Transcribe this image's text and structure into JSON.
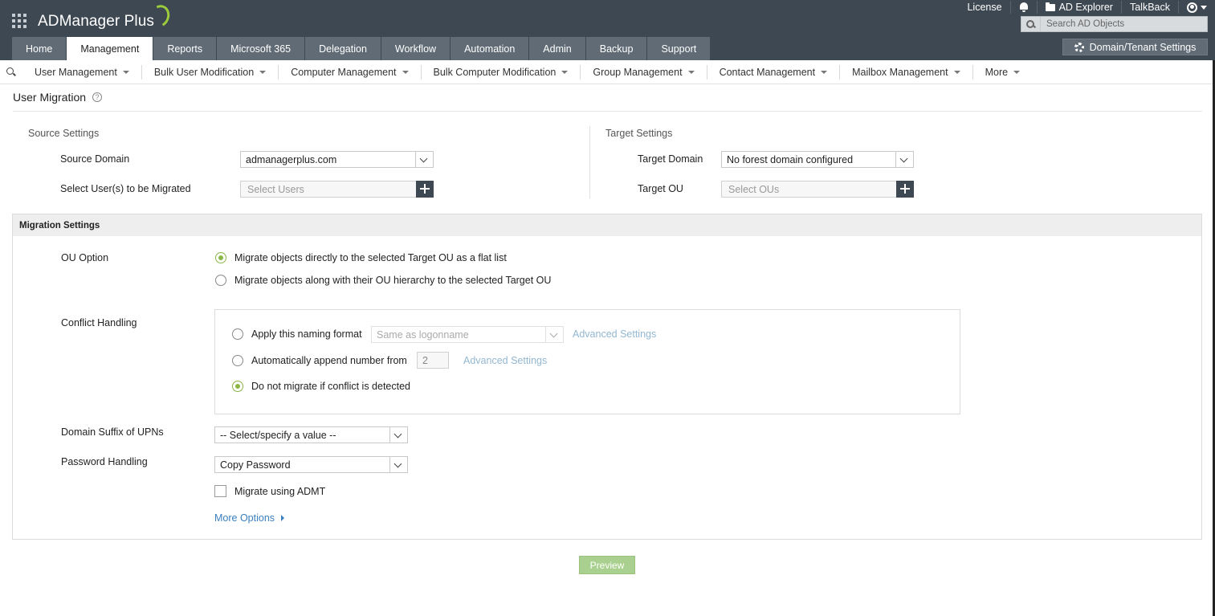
{
  "app": {
    "name": "ADManager Plus"
  },
  "header": {
    "links": {
      "license": "License",
      "ad_explorer": "AD Explorer",
      "talkback": "TalkBack"
    },
    "search_placeholder": "Search AD Objects",
    "domain_settings": "Domain/Tenant Settings"
  },
  "tabs": [
    {
      "label": "Home"
    },
    {
      "label": "Management"
    },
    {
      "label": "Reports"
    },
    {
      "label": "Microsoft 365"
    },
    {
      "label": "Delegation"
    },
    {
      "label": "Workflow"
    },
    {
      "label": "Automation"
    },
    {
      "label": "Admin"
    },
    {
      "label": "Backup"
    },
    {
      "label": "Support"
    }
  ],
  "active_tab": "Management",
  "submenu": [
    {
      "label": "User Management"
    },
    {
      "label": "Bulk User Modification"
    },
    {
      "label": "Computer Management"
    },
    {
      "label": "Bulk Computer Modification"
    },
    {
      "label": "Group Management"
    },
    {
      "label": "Contact Management"
    },
    {
      "label": "Mailbox Management"
    },
    {
      "label": "More"
    }
  ],
  "page": {
    "title": "User Migration",
    "help": "?"
  },
  "source": {
    "heading": "Source Settings",
    "domain_label": "Source Domain",
    "domain_value": "admanagerplus.com",
    "users_label": "Select User(s) to be Migrated",
    "users_placeholder": "Select Users"
  },
  "target": {
    "heading": "Target Settings",
    "domain_label": "Target Domain",
    "domain_value": "No forest domain configured",
    "ou_label": "Target OU",
    "ou_placeholder": "Select OUs"
  },
  "migration": {
    "heading": "Migration Settings",
    "ou_option_label": "OU Option",
    "ou_options": [
      {
        "label": "Migrate objects directly to the selected Target OU as a flat list",
        "selected": true
      },
      {
        "label": "Migrate objects along with their OU hierarchy to the selected Target OU",
        "selected": false
      }
    ],
    "conflict_label": "Conflict Handling",
    "conflict": {
      "naming_format_label": "Apply this naming format",
      "naming_format_value": "Same as logonname",
      "append_label": "Automatically append number from",
      "append_value": "2",
      "advanced": "Advanced Settings",
      "do_not_migrate_label": "Do not migrate if conflict is detected",
      "selected": "do_not_migrate"
    },
    "upn_label": "Domain Suffix of UPNs",
    "upn_value": "-- Select/specify a value --",
    "password_label": "Password Handling",
    "password_value": "Copy Password",
    "admt_label": "Migrate using ADMT",
    "admt_checked": false,
    "more_options": "More Options"
  },
  "actions": {
    "preview": "Preview"
  },
  "colors": {
    "header_bg": "#3e4852",
    "tab_bg": "#606b75",
    "accent_green": "#8ab547",
    "link_blue": "#3a7fbf",
    "preview_bg": "#a9d08e"
  }
}
